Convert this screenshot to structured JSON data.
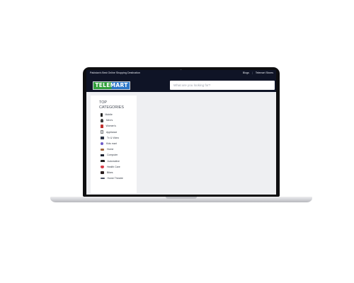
{
  "topbar": {
    "tagline": "Pakistan's Best Online Shopping Destination",
    "links": [
      "Blogs",
      "Telemart Stores"
    ],
    "separator": "|"
  },
  "header": {
    "logo_text": "TELEMART",
    "search_placeholder": "What are you looking for?"
  },
  "categories": {
    "title": "TOP CATEGORIES",
    "items": [
      {
        "label": "Mobile",
        "icon": "mobile-icon"
      },
      {
        "label": "Men's",
        "icon": "men-icon"
      },
      {
        "label": "Women's",
        "icon": "women-icon"
      },
      {
        "label": "Appliance",
        "icon": "appliance-icon"
      },
      {
        "label": "Tv & Video",
        "icon": "tv-icon"
      },
      {
        "label": "Kids mart",
        "icon": "kids-icon"
      },
      {
        "label": "Home",
        "icon": "home-icon"
      },
      {
        "label": "Computer",
        "icon": "computer-icon"
      },
      {
        "label": "Automotive",
        "icon": "car-icon"
      },
      {
        "label": "Health Care",
        "icon": "health-icon"
      },
      {
        "label": "Bikes",
        "icon": "bike-icon"
      },
      {
        "label": "Home Theatre",
        "icon": "theatre-icon"
      }
    ]
  },
  "colors": {
    "header_bg": "#0f1426",
    "logo_green": "#2f9e3a",
    "logo_blue": "#2b76c8",
    "page_bg": "#eeeff2"
  }
}
